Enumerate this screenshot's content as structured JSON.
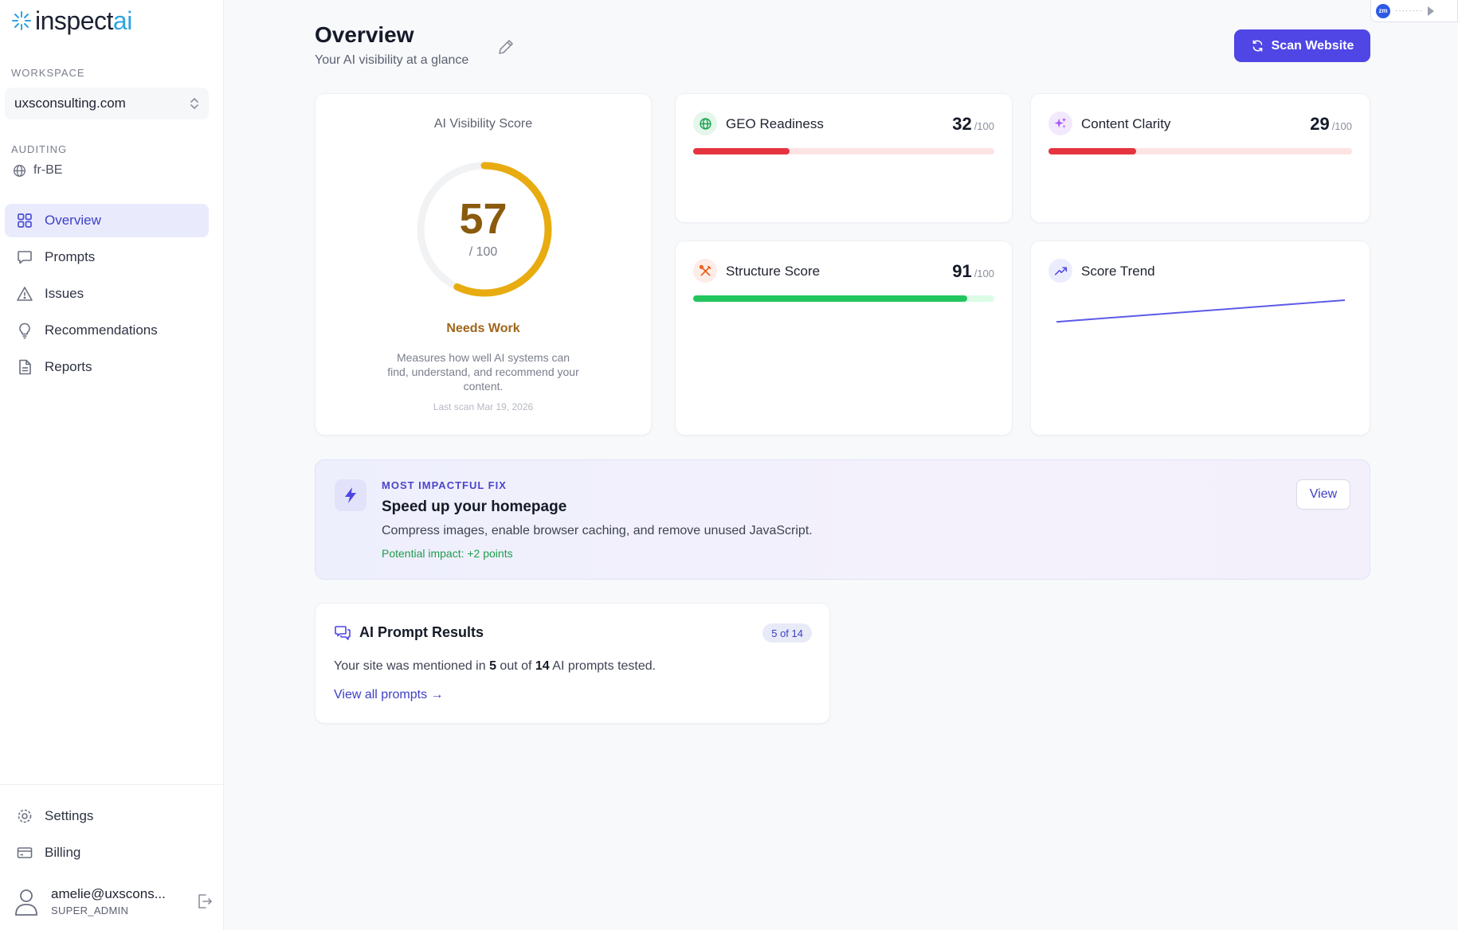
{
  "app": {
    "logo_main": "inspect",
    "logo_accent": "ai"
  },
  "sidebar": {
    "workspace_label": "WORKSPACE",
    "workspace_value": "uxsconsulting.com",
    "auditing_label": "AUDITING",
    "locale": "fr-BE",
    "nav": [
      {
        "label": "Overview",
        "icon": "grid-icon",
        "active": true
      },
      {
        "label": "Prompts",
        "icon": "chat-icon"
      },
      {
        "label": "Issues",
        "icon": "warning-icon"
      },
      {
        "label": "Recommendations",
        "icon": "lightbulb-icon"
      },
      {
        "label": "Reports",
        "icon": "document-icon"
      }
    ],
    "bottom_nav": [
      {
        "label": "Settings",
        "icon": "gear-icon"
      },
      {
        "label": "Billing",
        "icon": "credit-card-icon"
      }
    ],
    "user": {
      "email": "amelie@uxscons...",
      "role": "SUPER_ADMIN"
    }
  },
  "header": {
    "title": "Overview",
    "subtitle": "Your AI visibility at a glance",
    "scan_label": "Scan Website"
  },
  "score": {
    "title": "AI Visibility Score",
    "value": "57",
    "max": "/ 100",
    "fraction": 0.57,
    "status": "Needs Work",
    "description": "Measures how well AI systems can find, understand, and recommend your content.",
    "last_scan": "Last scan Mar 19, 2026",
    "color": "#e8ac10"
  },
  "metrics": {
    "geo": {
      "name": "GEO Readiness",
      "value": "32",
      "suffix": "/100",
      "fraction": 0.32,
      "color": "#e5343f",
      "track": "#fde3e4",
      "icon": "globe-icon"
    },
    "clarity": {
      "name": "Content Clarity",
      "value": "29",
      "suffix": "/100",
      "fraction": 0.29,
      "color": "#e5343f",
      "track": "#fde3e4",
      "icon": "sparkles-icon"
    },
    "structure": {
      "name": "Structure Score",
      "value": "91",
      "suffix": "/100",
      "fraction": 0.91,
      "color": "#22c55e",
      "track": "#dcfce7",
      "icon": "tools-icon"
    },
    "trend": {
      "name": "Score Trend",
      "icon": "trend-up-icon",
      "points": [
        0.15,
        1.0
      ],
      "color": "#5b5be8"
    }
  },
  "fix": {
    "label": "MOST IMPACTFUL FIX",
    "title": "Speed up your homepage",
    "description": "Compress images, enable browser caching, and remove unused JavaScript.",
    "impact": "Potential impact: +2 points",
    "view_label": "View"
  },
  "prompts": {
    "title": "AI Prompt Results",
    "badge": "5 of 14",
    "sentence_pre": "Your site was mentioned in ",
    "mentioned": "5",
    "sentence_mid": " out of ",
    "total": "14",
    "sentence_post": " AI prompts tested.",
    "link": "View all prompts →"
  },
  "zoom_widget": {
    "logo": "zm"
  }
}
